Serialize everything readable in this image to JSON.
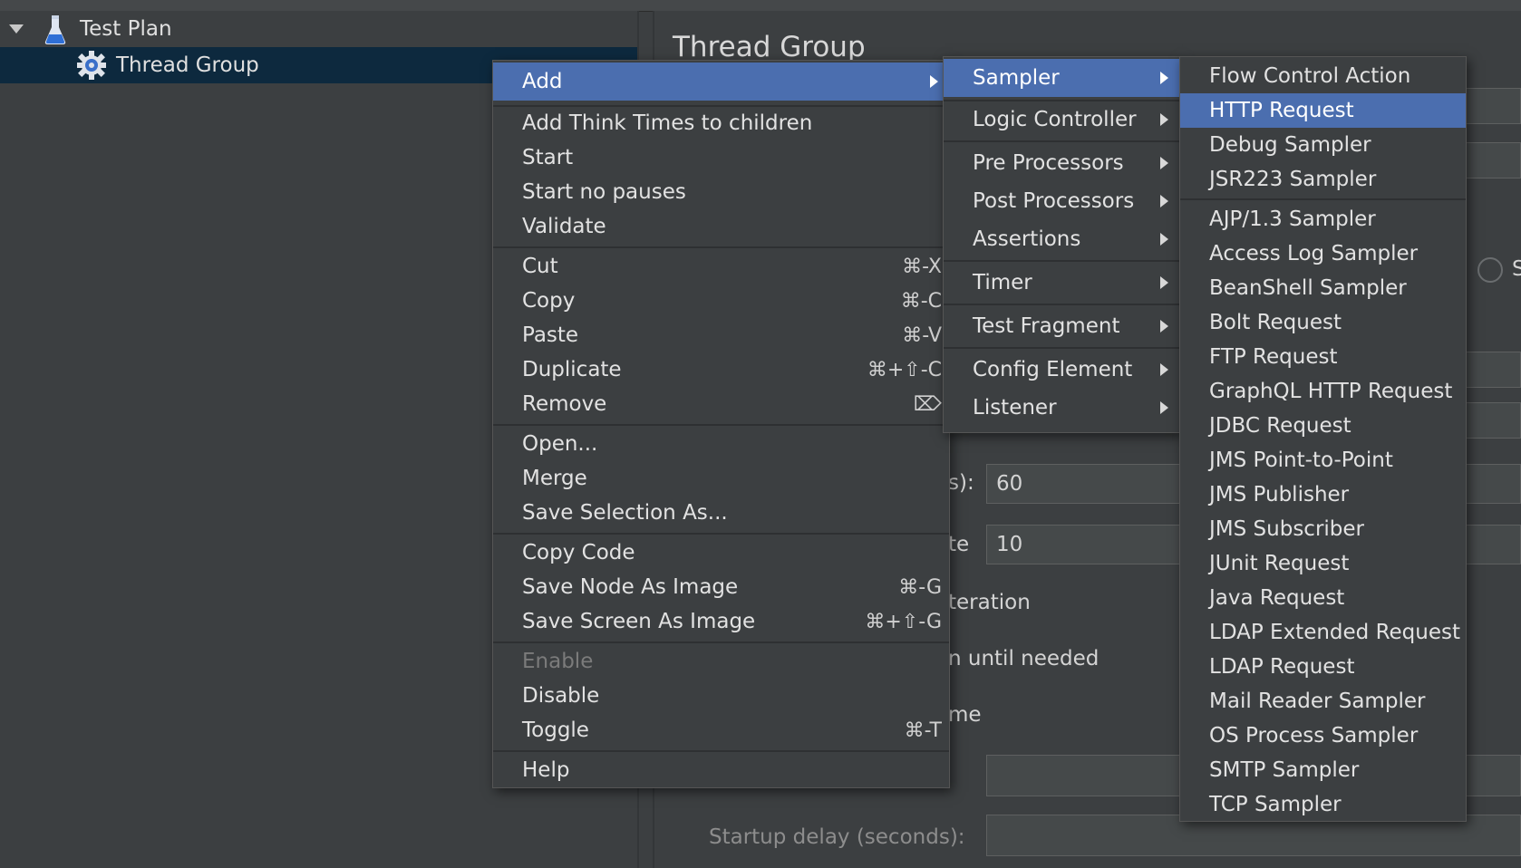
{
  "tree": {
    "items": [
      {
        "label": "Test Plan",
        "icon": "flask-icon"
      },
      {
        "label": "Thread Group",
        "icon": "gear-icon"
      }
    ]
  },
  "panel": {
    "title": "Thread Group",
    "partial_labels": {
      "ramp": "s):",
      "loop": "te",
      "iteration": "teration",
      "delay": "n until needed",
      "me": "me",
      "startup": "Startup delay (seconds):",
      "radio_s": "S"
    },
    "fields": {
      "ramp_value": "60",
      "loop_value": "10"
    }
  },
  "context_menu": {
    "items": [
      {
        "label": "Add",
        "submenu": true,
        "highlighted": true
      },
      {
        "label": "Add Think Times to children"
      },
      {
        "label": "Start"
      },
      {
        "label": "Start no pauses"
      },
      {
        "label": "Validate"
      },
      {
        "label": "Cut",
        "shortcut": "⌘-X"
      },
      {
        "label": "Copy",
        "shortcut": "⌘-C"
      },
      {
        "label": "Paste",
        "shortcut": "⌘-V"
      },
      {
        "label": "Duplicate",
        "shortcut": "⌘+⇧-C"
      },
      {
        "label": "Remove",
        "shortcut": "⌦"
      },
      {
        "label": "Open..."
      },
      {
        "label": "Merge"
      },
      {
        "label": "Save Selection As..."
      },
      {
        "label": "Copy Code"
      },
      {
        "label": "Save Node As Image",
        "shortcut": "⌘-G"
      },
      {
        "label": "Save Screen As Image",
        "shortcut": "⌘+⇧-G"
      },
      {
        "label": "Enable",
        "disabled": true
      },
      {
        "label": "Disable"
      },
      {
        "label": "Toggle",
        "shortcut": "⌘-T"
      },
      {
        "label": "Help"
      }
    ]
  },
  "add_submenu": {
    "items": [
      {
        "label": "Sampler",
        "highlighted": true
      },
      {
        "label": "Logic Controller"
      },
      {
        "label": "Pre Processors"
      },
      {
        "label": "Post Processors"
      },
      {
        "label": "Assertions"
      },
      {
        "label": "Timer"
      },
      {
        "label": "Test Fragment"
      },
      {
        "label": "Config Element"
      },
      {
        "label": "Listener"
      }
    ]
  },
  "sampler_submenu": {
    "items": [
      {
        "label": "Flow Control Action"
      },
      {
        "label": "HTTP Request",
        "highlighted": true
      },
      {
        "label": "Debug Sampler"
      },
      {
        "label": "JSR223 Sampler"
      },
      {
        "label": "AJP/1.3 Sampler"
      },
      {
        "label": "Access Log Sampler"
      },
      {
        "label": "BeanShell Sampler"
      },
      {
        "label": "Bolt Request"
      },
      {
        "label": "FTP Request"
      },
      {
        "label": "GraphQL HTTP Request"
      },
      {
        "label": "JDBC Request"
      },
      {
        "label": "JMS Point-to-Point"
      },
      {
        "label": "JMS Publisher"
      },
      {
        "label": "JMS Subscriber"
      },
      {
        "label": "JUnit Request"
      },
      {
        "label": "Java Request"
      },
      {
        "label": "LDAP Extended Request"
      },
      {
        "label": "LDAP Request"
      },
      {
        "label": "Mail Reader Sampler"
      },
      {
        "label": "OS Process Sampler"
      },
      {
        "label": "SMTP Sampler"
      },
      {
        "label": "TCP Sampler"
      }
    ]
  },
  "colors": {
    "highlight": "#4b6eaf",
    "tree_selected": "#0d293e",
    "background": "#3c3f41"
  }
}
